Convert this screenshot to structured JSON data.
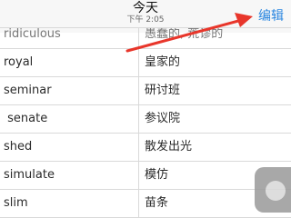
{
  "header": {
    "title": "今天",
    "subtitle": "下午 2:05",
    "edit_label": "编辑"
  },
  "rows": [
    {
      "en": "ridiculous",
      "zh": "愚蠢的, 荒谬的"
    },
    {
      "en": "royal",
      "zh": "皇家的"
    },
    {
      "en": "seminar",
      "zh": "研讨班"
    },
    {
      "en": " senate",
      "zh": "参议院"
    },
    {
      "en": "shed",
      "zh": "散发出光"
    },
    {
      "en": "simulate",
      "zh": "模仿"
    },
    {
      "en": "slim",
      "zh": "苗条"
    }
  ],
  "colors": {
    "accent": "#2a86e0",
    "annotation_arrow": "#e8362b"
  }
}
